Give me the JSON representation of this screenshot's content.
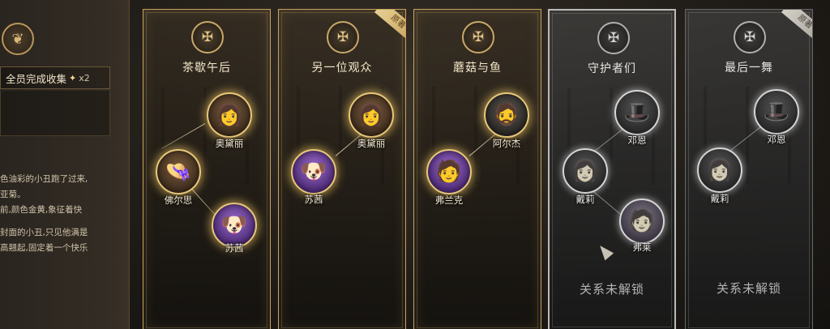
{
  "left_panel": {
    "crest_icon": "feather-crest",
    "collect_label": "全员完成收集",
    "collect_multiplier": "x2",
    "description": [
      "色油彩的小丑跑了过来,",
      "亚菊。",
      "前,颜色金黄,象征着快",
      "封面的小丑,只见他满是",
      "高翘起,固定着一个快乐"
    ]
  },
  "cards": [
    {
      "title": "茶歇午后",
      "badge": "",
      "characters": [
        {
          "name": "奥黛丽",
          "icon": "lady-portrait"
        },
        {
          "name": "佛尔思",
          "icon": "hat-lady-portrait"
        },
        {
          "name": "苏茜",
          "icon": "dog-portrait"
        }
      ]
    },
    {
      "title": "另一位观众",
      "badge": "原著",
      "characters": [
        {
          "name": "奥黛丽",
          "icon": "lady-portrait"
        },
        {
          "name": "苏茜",
          "icon": "dog-portrait"
        }
      ]
    },
    {
      "title": "蘑菇与鱼",
      "badge": "",
      "characters": [
        {
          "name": "阿尔杰",
          "icon": "sailor-portrait"
        },
        {
          "name": "弗兰克",
          "icon": "goggles-portrait"
        }
      ]
    },
    {
      "title": "守护者们",
      "badge": "",
      "lock_text": "关系未解锁",
      "characters": [
        {
          "name": "邓恩",
          "icon": "fedora-man-portrait"
        },
        {
          "name": "戴莉",
          "icon": "veil-lady-portrait"
        },
        {
          "name": "弗莱",
          "icon": "young-man-portrait"
        }
      ]
    },
    {
      "title": "最后一舞",
      "badge": "原著",
      "lock_text": "关系未解锁",
      "characters": [
        {
          "name": "邓恩",
          "icon": "fedora-man-portrait"
        },
        {
          "name": "戴莉",
          "icon": "veil-lady-portrait"
        }
      ]
    }
  ]
}
